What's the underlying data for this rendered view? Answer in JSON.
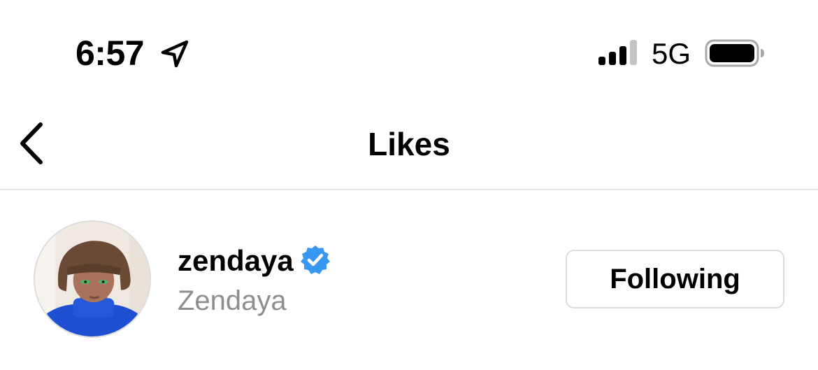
{
  "status_bar": {
    "time": "6:57",
    "network": "5G",
    "icons": [
      "location-arrow-icon",
      "cellular-signal-icon",
      "battery-icon"
    ]
  },
  "nav": {
    "title": "Likes",
    "back_icon": "chevron-left-icon"
  },
  "likes_list": [
    {
      "username": "zendaya",
      "full_name": "Zendaya",
      "verified": true,
      "verified_color": "#3897f0",
      "button_label": "Following"
    }
  ],
  "colors": {
    "secondary_text": "#8e8e8e",
    "divider": "#e6e6e6",
    "button_border": "#dbdbdb"
  }
}
